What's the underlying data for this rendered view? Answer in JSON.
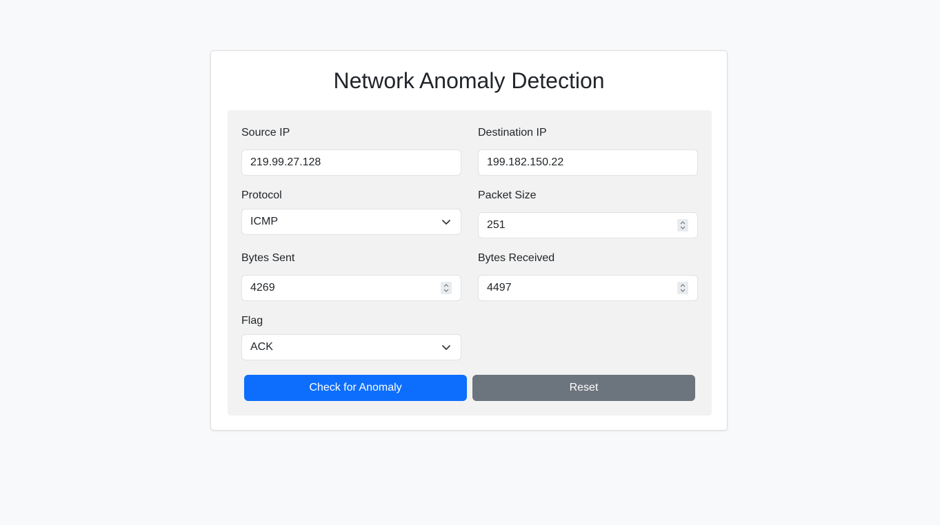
{
  "page": {
    "title": "Network Anomaly Detection"
  },
  "form": {
    "source_ip": {
      "label": "Source IP",
      "value": "219.99.27.128"
    },
    "destination_ip": {
      "label": "Destination IP",
      "value": "199.182.150.22"
    },
    "protocol": {
      "label": "Protocol",
      "value": "ICMP"
    },
    "packet_size": {
      "label": "Packet Size",
      "value": "251"
    },
    "bytes_sent": {
      "label": "Bytes Sent",
      "value": "4269"
    },
    "bytes_received": {
      "label": "Bytes Received",
      "value": "4497"
    },
    "flag": {
      "label": "Flag",
      "value": "ACK"
    }
  },
  "actions": {
    "check_label": "Check for Anomaly",
    "reset_label": "Reset"
  },
  "colors": {
    "primary": "#0d6efd",
    "secondary": "#6c757d",
    "page_background": "#f8f9fa",
    "panel_background": "#f2f2f2"
  },
  "icons": {
    "select_arrow": "chevron-down-icon",
    "number_spinner": "spinner-arrows-icon"
  }
}
